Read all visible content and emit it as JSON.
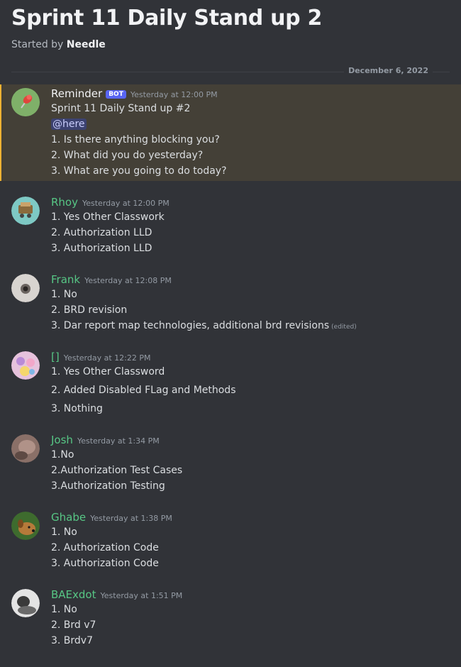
{
  "thread": {
    "title": "Sprint 11 Daily Stand up 2",
    "started_by_prefix": "Started by",
    "started_by": "Needle",
    "date_divider": "December 6, 2022"
  },
  "colors": {
    "username_green": "#57c785",
    "highlight_border": "#f0b232",
    "bot_badge": "#5865f2"
  },
  "messages": [
    {
      "author": "Reminder",
      "badge": "BOT",
      "time": "Yesterday at 12:00 PM",
      "avatar_icon": "pushpin-icon",
      "mention": "@here",
      "lines": [
        "Sprint 11 Daily Stand up #2",
        "1. Is there anything blocking you?",
        "2. What did you do yesterday?",
        "3. What are you going to do today?"
      ]
    },
    {
      "author": "Rhoy",
      "time": "Yesterday at 12:00 PM",
      "lines": [
        "1. Yes Other Classwork",
        "2. Authorization LLD",
        "3. Authorization LLD"
      ]
    },
    {
      "author": "Frank",
      "time": "Yesterday at 12:08 PM",
      "lines": [
        "1. No",
        "2. BRD revision",
        "3. Dar report map technologies, additional brd revisions"
      ],
      "edited": "(edited)"
    },
    {
      "author": "[]",
      "time": "Yesterday at 12:22 PM",
      "lines": [
        "1. Yes Other Classword",
        "2. Added Disabled FLag and Methods",
        "3. Nothing"
      ]
    },
    {
      "author": "Josh",
      "time": "Yesterday at 1:34 PM",
      "lines": [
        "1.No",
        "2.Authorization Test Cases",
        "3.Authorization Testing"
      ]
    },
    {
      "author": "Ghabe",
      "time": "Yesterday at 1:38 PM",
      "lines": [
        "1. No",
        "2. Authorization Code",
        "3. Authorization Code"
      ]
    },
    {
      "author": "BAExdot",
      "time": "Yesterday at 1:51 PM",
      "lines": [
        "1. No",
        "2. Brd v7",
        "3. Brdv7"
      ]
    }
  ]
}
